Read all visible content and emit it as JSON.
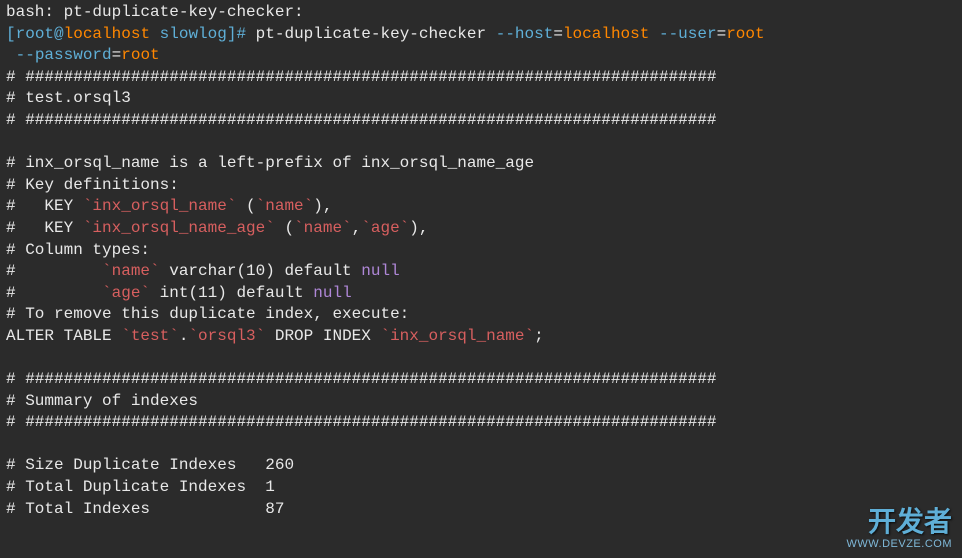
{
  "line0": "bash: pt-duplicate-key-checker:",
  "prompt": {
    "open": "[",
    "user": "root",
    "at": "@",
    "host": "localhost",
    "dir": " slowlog",
    "close": "]#"
  },
  "command": {
    "exe": " pt-duplicate-key-checker",
    "sp": " ",
    "host_flag": "--host",
    "eq1": "=",
    "host_val": "localhost",
    "user_flag": "--user",
    "eq2": "=",
    "user_val": "root",
    "indent": " ",
    "pw_flag": "--password",
    "eq3": "=",
    "pw_val": "root"
  },
  "divider": "# ########################################################################",
  "schema_line": "# test.orsql3",
  "blank": "",
  "dup_header": "# inx_orsql_name is a left-prefix of inx_orsql_name_age",
  "keydefs": "# Key definitions:",
  "key1": {
    "p1": "#   KEY ",
    "name": "`inx_orsql_name`",
    "p2": " (",
    "col": "`name`",
    "p3": "),"
  },
  "key2": {
    "p1": "#   KEY ",
    "name": "`inx_orsql_name_age`",
    "p2": " (",
    "col1": "`name`",
    "comma": ",",
    "col2": "`age`",
    "p3": "),"
  },
  "coltypes": "# Column types:",
  "col1": {
    "p1": "#         ",
    "name": "`name`",
    "p2": " varchar(10) default ",
    "null": "null"
  },
  "col2": {
    "p1": "#         ",
    "name": "`age`",
    "p2": " int(11) default ",
    "null": "null"
  },
  "remove_hint": "# To remove this duplicate index, execute:",
  "alter": {
    "p1": "ALTER TABLE ",
    "db": "`test`",
    "dot": ".",
    "tbl": "`orsql3`",
    "p2": " DROP INDEX ",
    "idx": "`inx_orsql_name`",
    "semi": ";"
  },
  "summary_hdr": "# Summary of indexes",
  "stats": {
    "size": "# Size Duplicate Indexes   260",
    "total_dup": "# Total Duplicate Indexes  1",
    "total_idx": "# Total Indexes            87"
  },
  "watermark": {
    "cn": "开发者",
    "en": "WWW.DEVZE.COM"
  }
}
